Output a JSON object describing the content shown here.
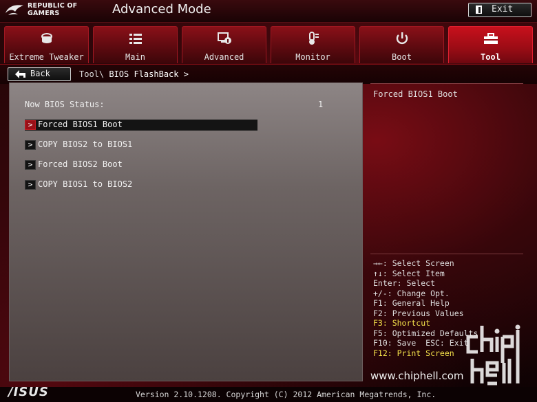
{
  "brand": {
    "line1": "REPUBLIC OF",
    "line2": "GAMERS"
  },
  "header": {
    "mode_title": "Advanced Mode",
    "exit_label": "Exit"
  },
  "tabs": [
    {
      "label": "Extreme Tweaker",
      "icon": "tweaker-icon"
    },
    {
      "label": "Main",
      "icon": "list-icon"
    },
    {
      "label": "Advanced",
      "icon": "advanced-settings-icon"
    },
    {
      "label": "Monitor",
      "icon": "thermometer-icon"
    },
    {
      "label": "Boot",
      "icon": "power-icon"
    },
    {
      "label": "Tool",
      "icon": "toolbox-icon",
      "active": true
    }
  ],
  "nav": {
    "back_label": "Back",
    "crumb_parent": "Tool\\ ",
    "crumb_current": "BIOS FlashBack >"
  },
  "main": {
    "status_label": "Now BIOS Status:",
    "status_value": "1",
    "items": [
      {
        "label": "Forced BIOS1 Boot",
        "selected": true
      },
      {
        "label": "COPY BIOS2 to BIOS1"
      },
      {
        "label": "Forced BIOS2 Boot"
      },
      {
        "label": "COPY BIOS1 to BIOS2"
      }
    ]
  },
  "help": {
    "title": "Forced BIOS1 Boot",
    "keys": [
      {
        "text": "→←: Select Screen"
      },
      {
        "text": "↑↓: Select Item"
      },
      {
        "text": "Enter: Select"
      },
      {
        "text": "+/-: Change Opt."
      },
      {
        "text": "F1: General Help"
      },
      {
        "text": "F2: Previous Values"
      },
      {
        "text": "F3: Shortcut",
        "highlight": true
      },
      {
        "text": "F5: Optimized Defaults"
      },
      {
        "text": "F10: Save  ESC: Exit"
      },
      {
        "text": "F12: Print Screen",
        "highlight": true
      }
    ]
  },
  "watermark": {
    "site": "www.chiphell.com"
  },
  "footer": {
    "logo_text": "/ISUS",
    "version": "Version 2.10.1208. Copyright (C) 2012 American Megatrends, Inc."
  },
  "colors": {
    "accent": "#c8101c",
    "highlight_key": "#f3e14a"
  }
}
